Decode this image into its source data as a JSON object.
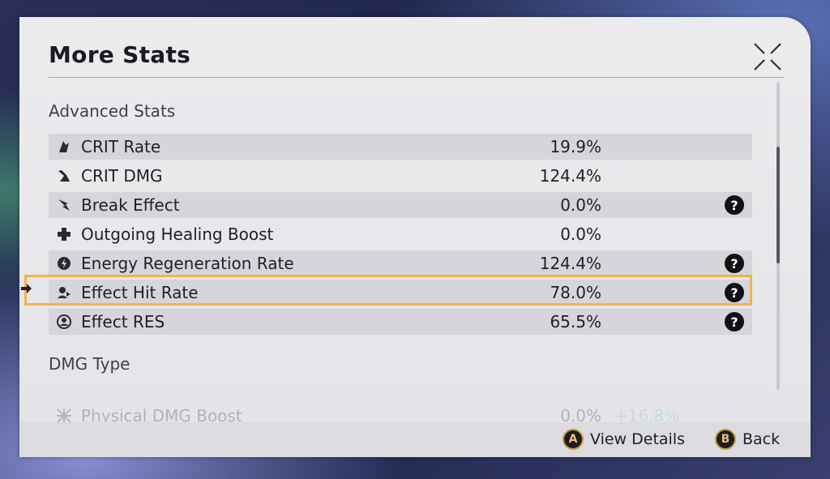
{
  "window": {
    "title": "More Stats"
  },
  "sections": {
    "advanced": {
      "title": "Advanced Stats",
      "rows": [
        {
          "label": "CRIT Rate",
          "value": "19.9%",
          "icon": "crit-rate-icon",
          "help": false
        },
        {
          "label": "CRIT DMG",
          "value": "124.4%",
          "icon": "crit-dmg-icon",
          "help": false
        },
        {
          "label": "Break Effect",
          "value": "0.0%",
          "icon": "break-effect-icon",
          "help": true
        },
        {
          "label": "Outgoing Healing Boost",
          "value": "0.0%",
          "icon": "healing-cross-icon",
          "help": false
        },
        {
          "label": "Energy Regeneration Rate",
          "value": "124.4%",
          "icon": "energy-regen-icon",
          "help": true
        },
        {
          "label": "Effect Hit Rate",
          "value": "78.0%",
          "icon": "effect-hit-rate-icon",
          "help": true
        },
        {
          "label": "Effect RES",
          "value": "65.5%",
          "icon": "effect-res-icon",
          "help": true
        }
      ]
    },
    "dmg_type": {
      "title": "DMG Type",
      "rows": [
        {
          "label": "Physical DMG Boost",
          "value": "0.0%",
          "bonus": "+16.8%",
          "icon": "physical-dmg-icon"
        }
      ]
    }
  },
  "help_glyph": "?",
  "footer": {
    "view_details": {
      "key": "A",
      "label": "View Details"
    },
    "back": {
      "key": "B",
      "label": "Back"
    }
  },
  "colors": {
    "highlight": "#f0b44c",
    "bonus": "#66b8e0",
    "panel": "#e8e8ec"
  }
}
